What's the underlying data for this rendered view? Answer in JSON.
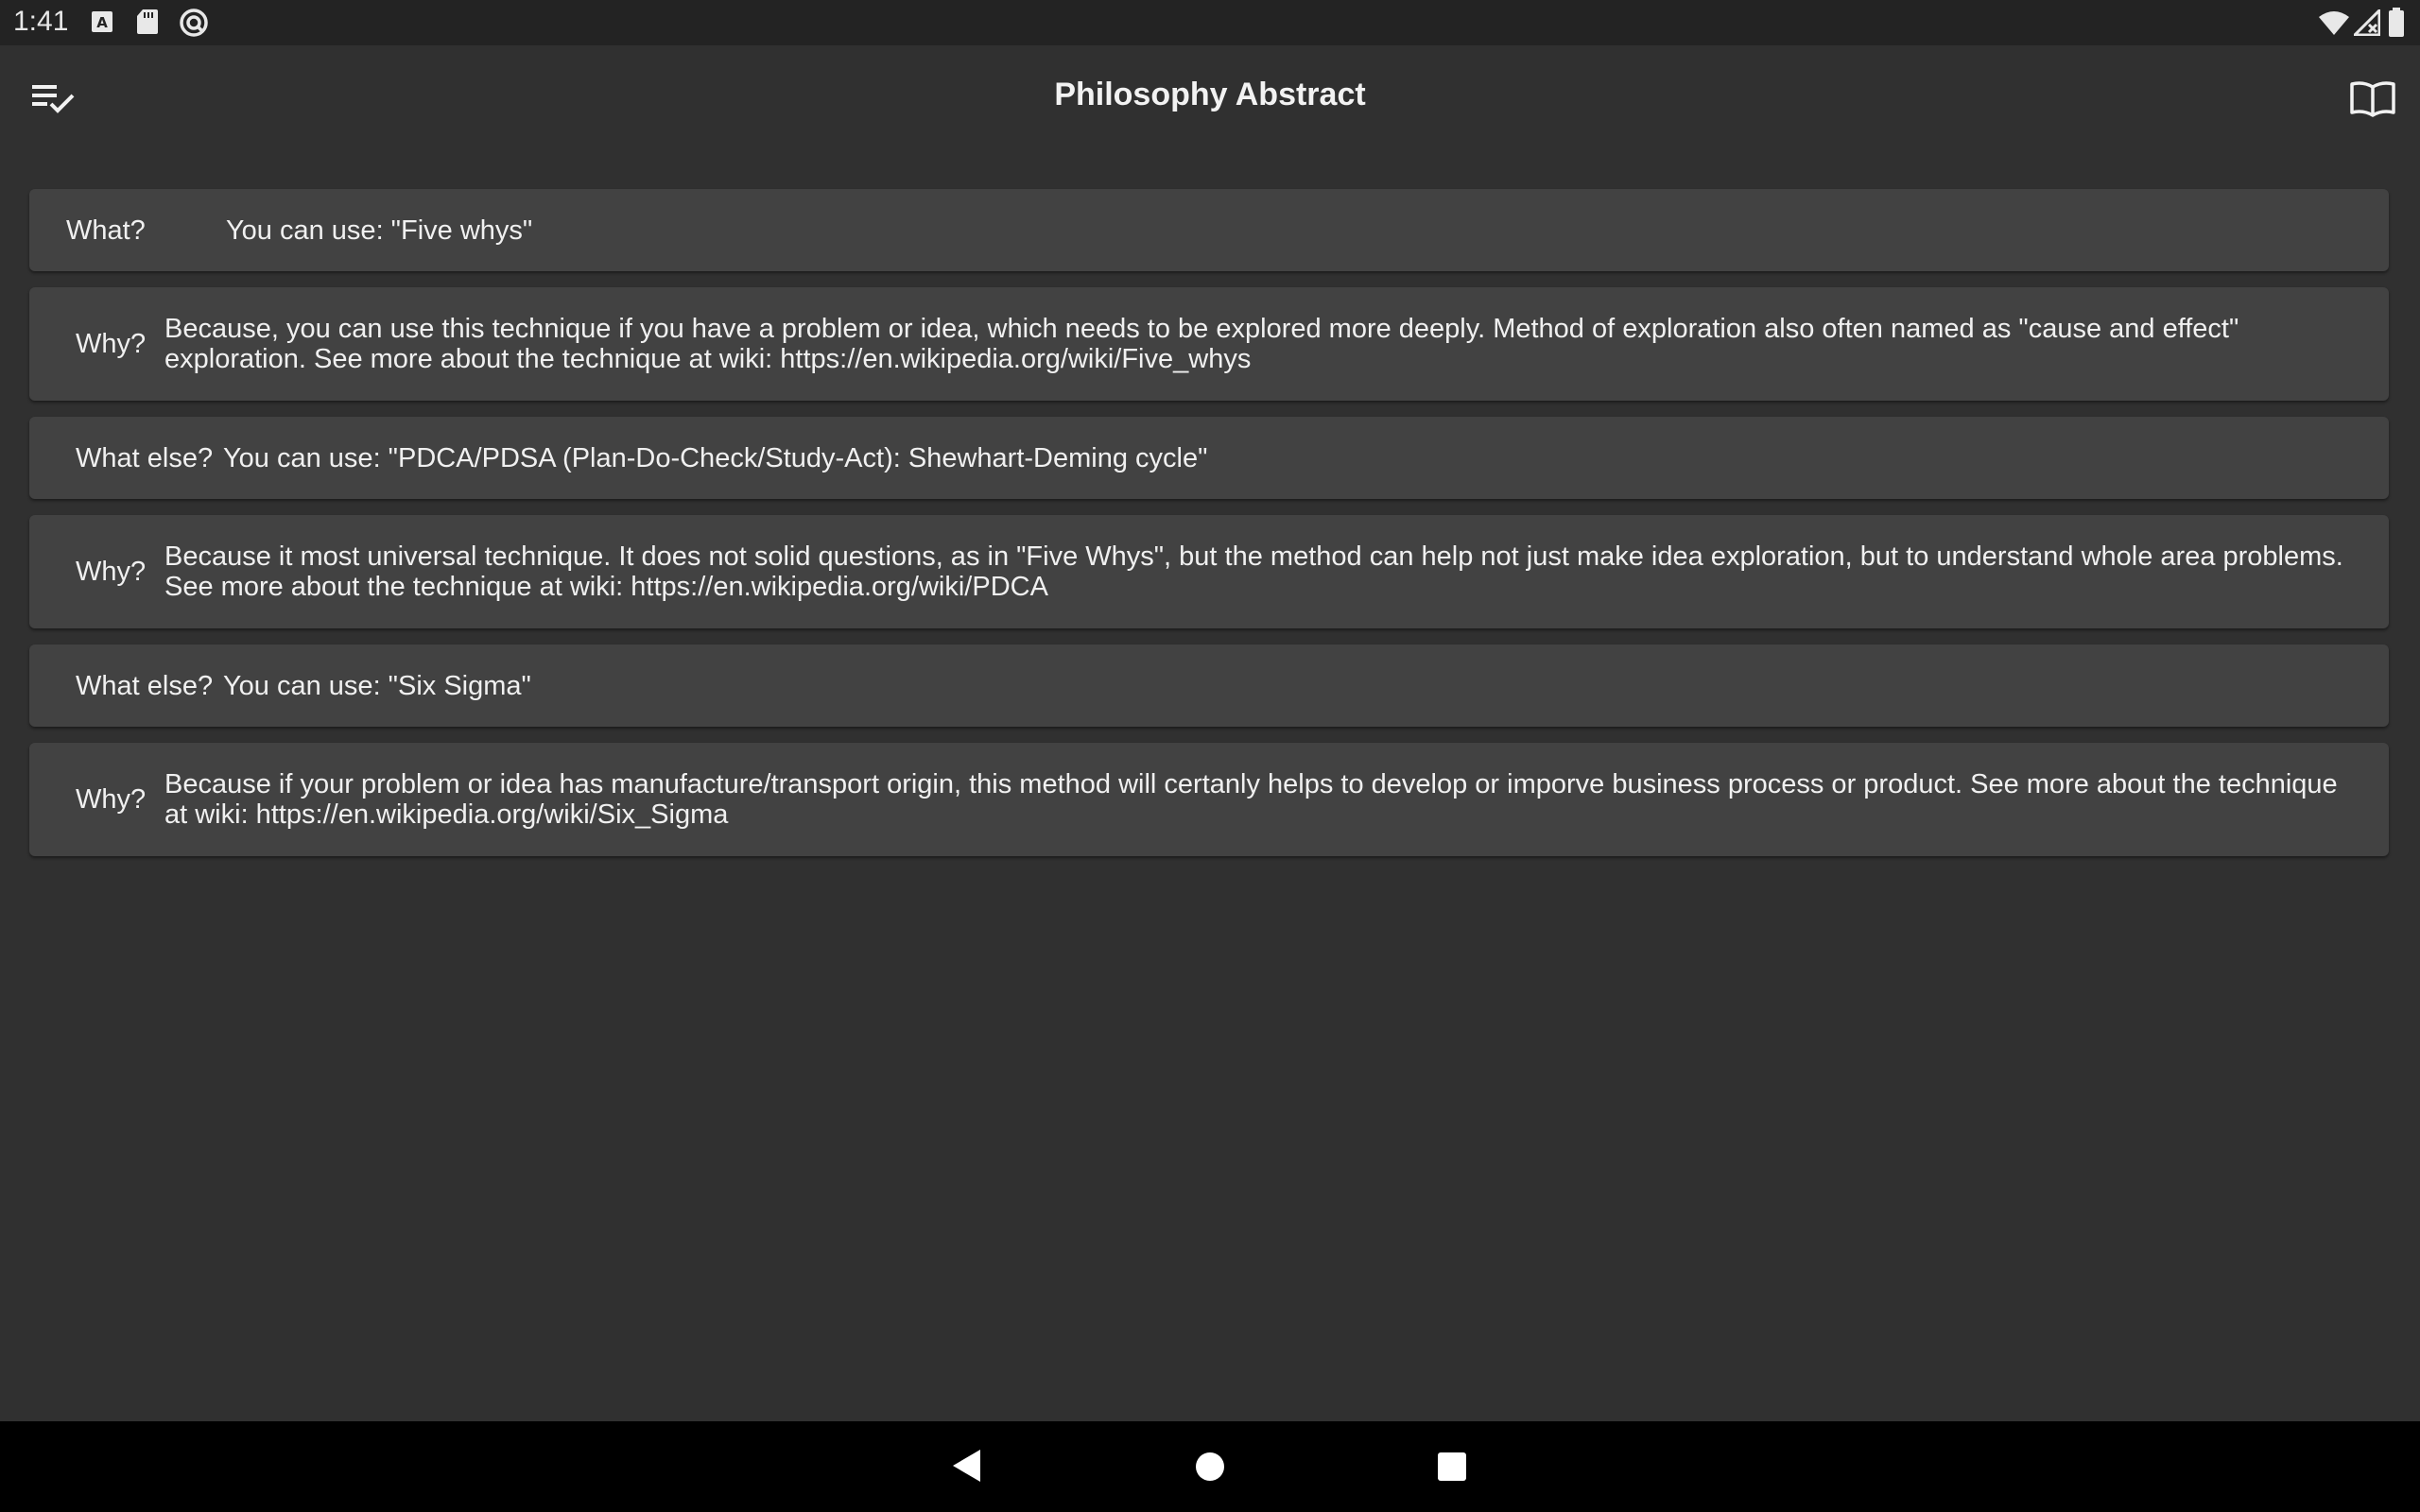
{
  "status_bar": {
    "time": "1:41",
    "left_icons": [
      "a-icon",
      "sd-card-icon",
      "sync-circle-icon"
    ],
    "right_icons": [
      "wifi-icon",
      "signal-icon",
      "battery-icon"
    ]
  },
  "app_bar": {
    "title": "Philosophy Abstract",
    "left_icon": "checklist-icon",
    "right_icon": "book-icon"
  },
  "cards": [
    {
      "label": "What?",
      "text": "You can use: \"Five whys\""
    },
    {
      "label": "Why?",
      "text": "Because, you can use this technique if you have a problem or idea, which needs to be explored more deeply. Method of exploration also often named as \"cause and effect\" exploration. See more about the technique at wiki: https://en.wikipedia.org/wiki/Five_whys"
    },
    {
      "label": "What else?",
      "text": "You can use: \"PDCA/PDSA (Plan-Do-Check/Study-Act): Shewhart-Deming cycle\""
    },
    {
      "label": "Why?",
      "text": "Because it most universal technique. It does not solid questions, as in \"Five Whys\", but the method can help not just make idea exploration, but to understand whole area problems. See more about the technique at wiki:  https://en.wikipedia.org/wiki/PDCA"
    },
    {
      "label": "What else?",
      "text": "You can use: \"Six Sigma\""
    },
    {
      "label": "Why?",
      "text": "Because if your problem or idea has manufacture/transport origin, this method will certanly helps to develop or imporve business process or product. See more about the technique at wiki:  https://en.wikipedia.org/wiki/Six_Sigma"
    }
  ],
  "nav_bar": {
    "buttons": [
      "back-icon",
      "home-icon",
      "recents-icon"
    ]
  },
  "colors": {
    "background": "#303030",
    "card": "#424242",
    "status_bar": "#232323",
    "nav_bar": "#000000",
    "text": "#f0f0f0"
  }
}
